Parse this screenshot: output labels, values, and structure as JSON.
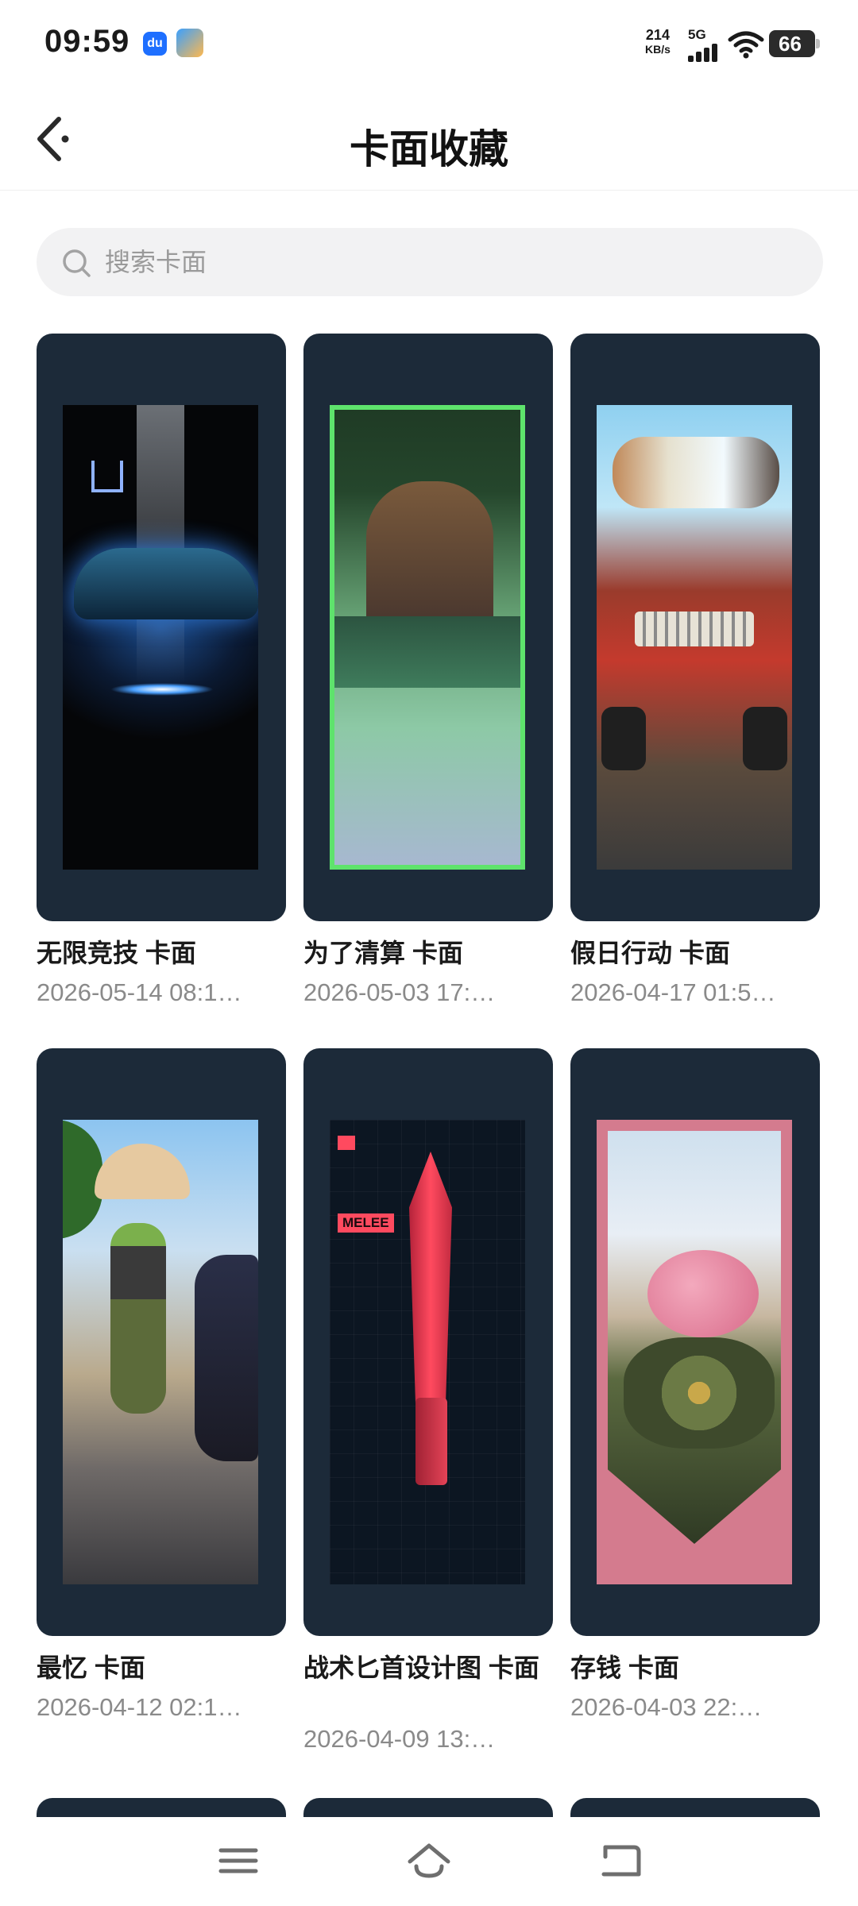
{
  "status_bar": {
    "time": "09:59",
    "app_icon_1": "du",
    "net_speed_value": "214",
    "net_speed_unit": "KB/s",
    "network_type": "5G",
    "battery": "66"
  },
  "header": {
    "title": "卡面收藏",
    "back_icon": "back-arrow-icon"
  },
  "search": {
    "placeholder": "搜索卡面",
    "value": ""
  },
  "cards": [
    {
      "title": "无限竞技 卡面",
      "date": "2026-05-14 08:1…"
    },
    {
      "title": "为了清算 卡面",
      "date": "2026-05-03 17:…"
    },
    {
      "title": "假日行动 卡面",
      "date": "2026-04-17 01:5…"
    },
    {
      "title": "最忆 卡面",
      "date": "2026-04-12 02:1…"
    },
    {
      "title": "战术匕首设计图 卡面",
      "date": "2026-04-09 13:…"
    },
    {
      "title": "存钱 卡面",
      "date": "2026-04-03 22:…"
    }
  ],
  "card_art_labels": {
    "knife_tag": "MELEE"
  },
  "nav_bar": {
    "items": [
      "menu-icon",
      "home-icon",
      "back-icon"
    ]
  },
  "colors": {
    "card_frame": "#1c2a39",
    "search_bg": "#f2f2f3",
    "date_text": "#8a8a8a"
  }
}
